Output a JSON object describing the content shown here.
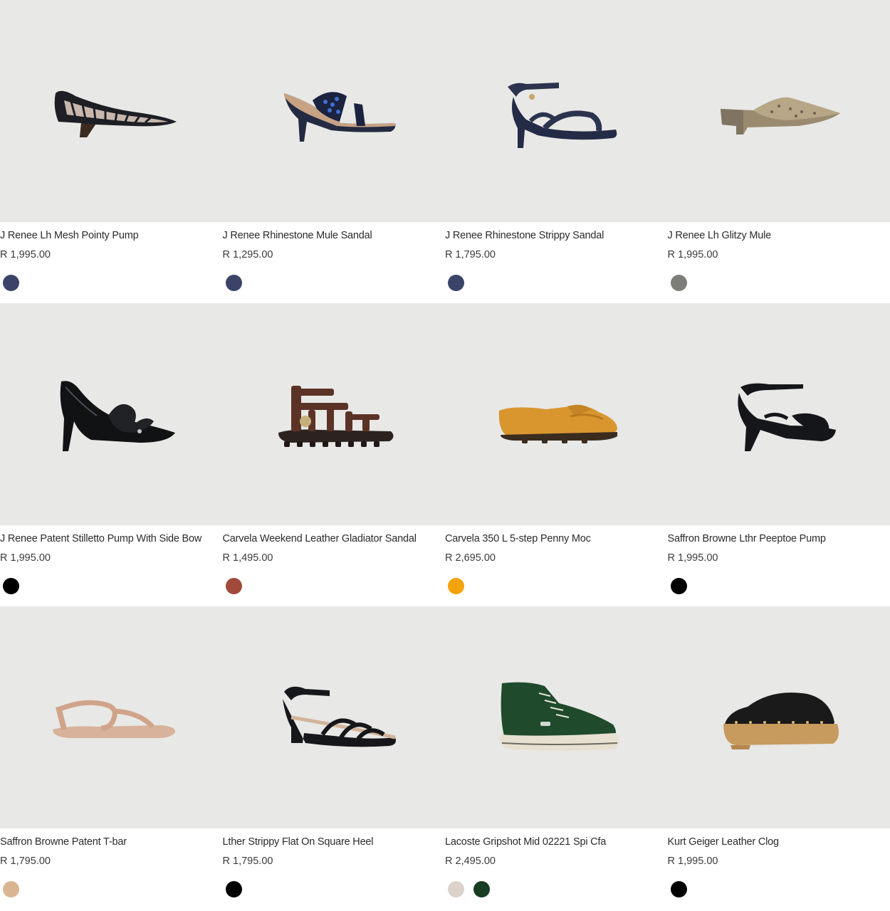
{
  "products": [
    {
      "name": "J Renee Lh Mesh Pointy Pump",
      "price": "R 1,995.00",
      "image": "black-mesh-pointy-pump-icon",
      "swatches": [
        "#3b4368"
      ]
    },
    {
      "name": "J Renee Rhinestone Mule Sandal",
      "price": "R 1,295.00",
      "image": "navy-rhinestone-mule-sandal-icon",
      "swatches": [
        "#3b4368"
      ]
    },
    {
      "name": "J Renee Rhinestone Strippy Sandal",
      "price": "R 1,795.00",
      "image": "navy-strappy-sandal-icon",
      "swatches": [
        "#3b4368"
      ]
    },
    {
      "name": "J Renee Lh Glitzy Mule",
      "price": "R 1,995.00",
      "image": "bronze-glitzy-mule-icon",
      "swatches": [
        "#7e7e78"
      ]
    },
    {
      "name": "J Renee Patent Stilletto Pump With Side Bow",
      "price": "R 1,995.00",
      "image": "black-patent-bow-pump-icon",
      "swatches": [
        "#000000"
      ]
    },
    {
      "name": "Carvela Weekend Leather Gladiator Sandal",
      "price": "R 1,495.00",
      "image": "brown-gladiator-sandal-icon",
      "swatches": [
        "#a14a3c"
      ]
    },
    {
      "name": "Carvela 350 L 5-step Penny Moc",
      "price": "R 2,695.00",
      "image": "tan-penny-moccasin-icon",
      "swatches": [
        "#f4a30e"
      ]
    },
    {
      "name": "Saffron Browne Lthr Peeptoe Pump",
      "price": "R 1,995.00",
      "image": "black-peeptoe-pump-icon",
      "swatches": [
        "#000000"
      ]
    },
    {
      "name": "Saffron Browne Patent T-bar",
      "price": "R 1,795.00",
      "image": "nude-t-bar-sandal-icon",
      "swatches": [
        "#d9b593"
      ]
    },
    {
      "name": "Lther Strippy Flat On Square Heel",
      "price": "R 1,795.00",
      "image": "black-strappy-flat-icon",
      "swatches": [
        "#000000"
      ]
    },
    {
      "name": "Lacoste Gripshot Mid 02221 Spi Cfa",
      "price": "R 2,495.00",
      "image": "green-mid-sneaker-icon",
      "swatches": [
        "#dcd2cc",
        "#173d22"
      ]
    },
    {
      "name": "Kurt Geiger Leather Clog",
      "price": "R 1,995.00",
      "image": "black-wooden-clog-icon",
      "swatches": [
        "#000000"
      ]
    }
  ]
}
